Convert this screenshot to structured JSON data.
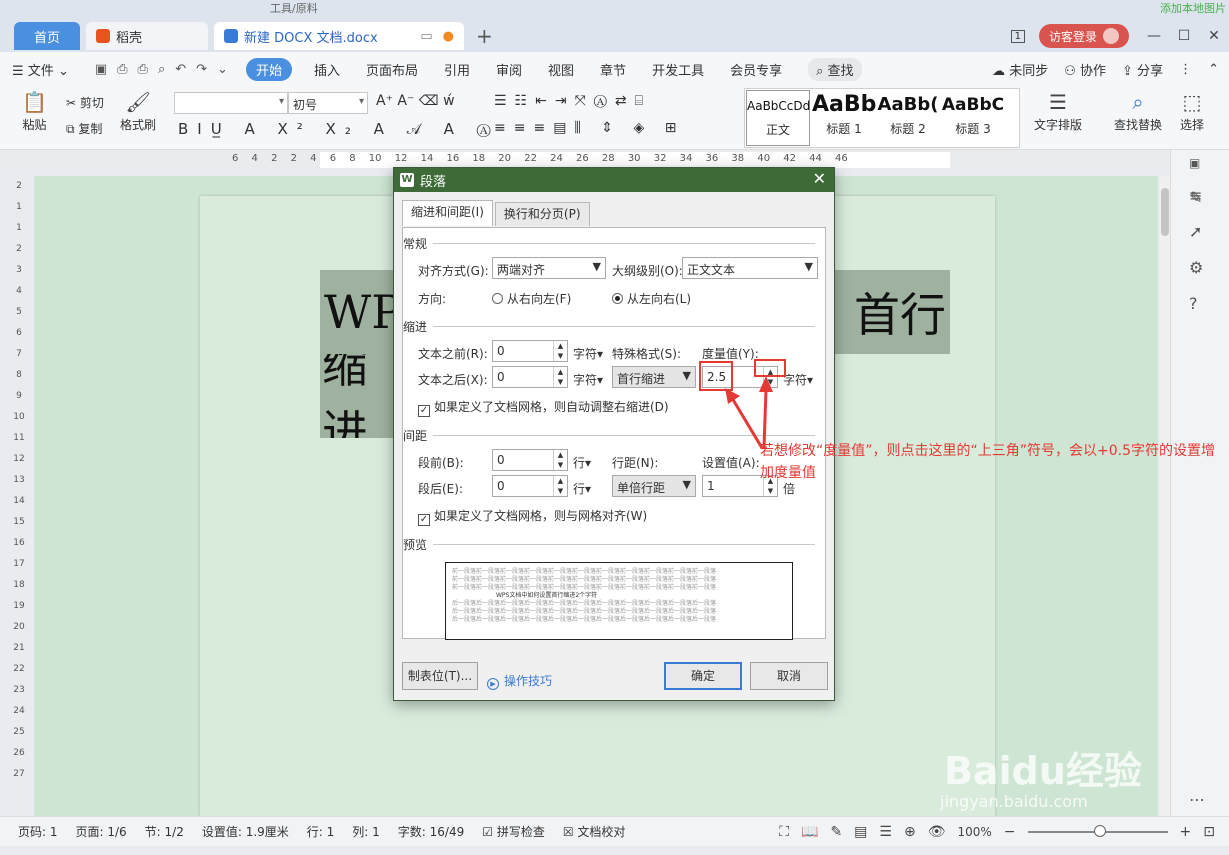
{
  "top_faint": {
    "left": "工具/原料",
    "right": "添加本地图片"
  },
  "tabs": {
    "home": "首页",
    "daoke": "稻壳",
    "doc": "新建 DOCX 文档.docx",
    "add": "+"
  },
  "titlebar": {
    "page_count": "1",
    "login": "访客登录"
  },
  "menu": {
    "file": "文件",
    "items": [
      "开始",
      "插入",
      "页面布局",
      "引用",
      "审阅",
      "视图",
      "章节",
      "开发工具",
      "会员专享",
      "查找"
    ],
    "right": [
      "未同步",
      "协作",
      "分享"
    ]
  },
  "ribbon": {
    "paste": "粘贴",
    "cut": "剪切",
    "copy": "复制",
    "format_painter": "格式刷",
    "font_size": "初号",
    "styles": [
      {
        "sample": "AaBbCcDd",
        "label": "正文"
      },
      {
        "sample": "AaBb",
        "label": "标题 1"
      },
      {
        "sample": "AaBb(",
        "label": "标题 2"
      },
      {
        "sample": "AaBbC",
        "label": "标题 3"
      }
    ],
    "text_layout": "文字排版",
    "find_replace": "查找替换",
    "select": "选择"
  },
  "ruler": {
    "numbers": "6 4 2 2 4 6 8 10 12 14 16 18 20 22 24 26 28 30 32 34 36 38 40 42 44 46"
  },
  "vruler": {
    "numbers": [
      "2",
      "1",
      "",
      "1",
      "2",
      "3",
      "4",
      "5",
      "6",
      "7",
      "8",
      "9",
      "10",
      "11",
      "12",
      "13",
      "14",
      "15",
      "16",
      "17",
      "18",
      "19",
      "20",
      "21",
      "22",
      "23",
      "24",
      "25",
      "26",
      "27"
    ]
  },
  "document": {
    "line1_left": "WP",
    "line1_right": "首行",
    "line2": "缩进"
  },
  "dialog": {
    "title": "段落",
    "tabs": [
      "缩进和间距(I)",
      "换行和分页(P)"
    ],
    "general": {
      "section": "常规",
      "align_label": "对齐方式(G):",
      "align_value": "两端对齐",
      "outline_label": "大纲级别(O):",
      "outline_value": "正文文本",
      "direction_label": "方向:",
      "rtl": "从右向左(F)",
      "ltr": "从左向右(L)"
    },
    "indent": {
      "section": "缩进",
      "before_label": "文本之前(R):",
      "before_value": "0",
      "before_unit": "字符▾",
      "after_label": "文本之后(X):",
      "after_value": "0",
      "after_unit": "字符▾",
      "special_label": "特殊格式(S):",
      "special_value": "首行缩进",
      "measure_label": "度量值(Y):",
      "measure_value": "2.5",
      "measure_unit": "字符▾",
      "grid_check": "如果定义了文档网格，则自动调整右缩进(D)"
    },
    "spacing": {
      "section": "间距",
      "before_label": "段前(B):",
      "before_value": "0",
      "before_unit": "行▾",
      "after_label": "段后(E):",
      "after_value": "0",
      "after_unit": "行▾",
      "line_label": "行距(N):",
      "line_value": "单倍行距",
      "set_label": "设置值(A):",
      "set_value": "1",
      "set_unit": "倍",
      "grid_check": "如果定义了文档网格，则与网格对齐(W)"
    },
    "preview": {
      "section": "预览",
      "filler": "前一段落前一段落前一段落前一段落前一段落前一段落前一段落前一段落前一段落前一段落前一段落",
      "main": "WPS文档中如何设置首行缩进2个字符",
      "filler_after": "后一段落后一段落后一段落后一段落后一段落后一段落后一段落后一段落后一段落后一段落后一段落"
    },
    "tabs_button": "制表位(T)...",
    "tips": "操作技巧",
    "ok": "确定",
    "cancel": "取消"
  },
  "annotation": {
    "text": "若想修改“度量值”，则点击这里的“上三角”符号，会以+0.5字符的设置增加度量值"
  },
  "statusbar": {
    "items": [
      "页码: 1",
      "页面: 1/6",
      "节: 1/2",
      "设置值: 1.9厘米",
      "行: 1",
      "列: 1",
      "字数: 16/49"
    ],
    "spell": "拼写检查",
    "proof": "文档校对",
    "zoom": "100%"
  },
  "watermark": {
    "brand": "Baidu经验",
    "url": "jingyan.baidu.com"
  },
  "colors": {
    "accent": "#4a8fe0",
    "dialog_title": "#3d6a37",
    "annotation": "#e53935",
    "doc_bg": "#cfe5d3"
  }
}
